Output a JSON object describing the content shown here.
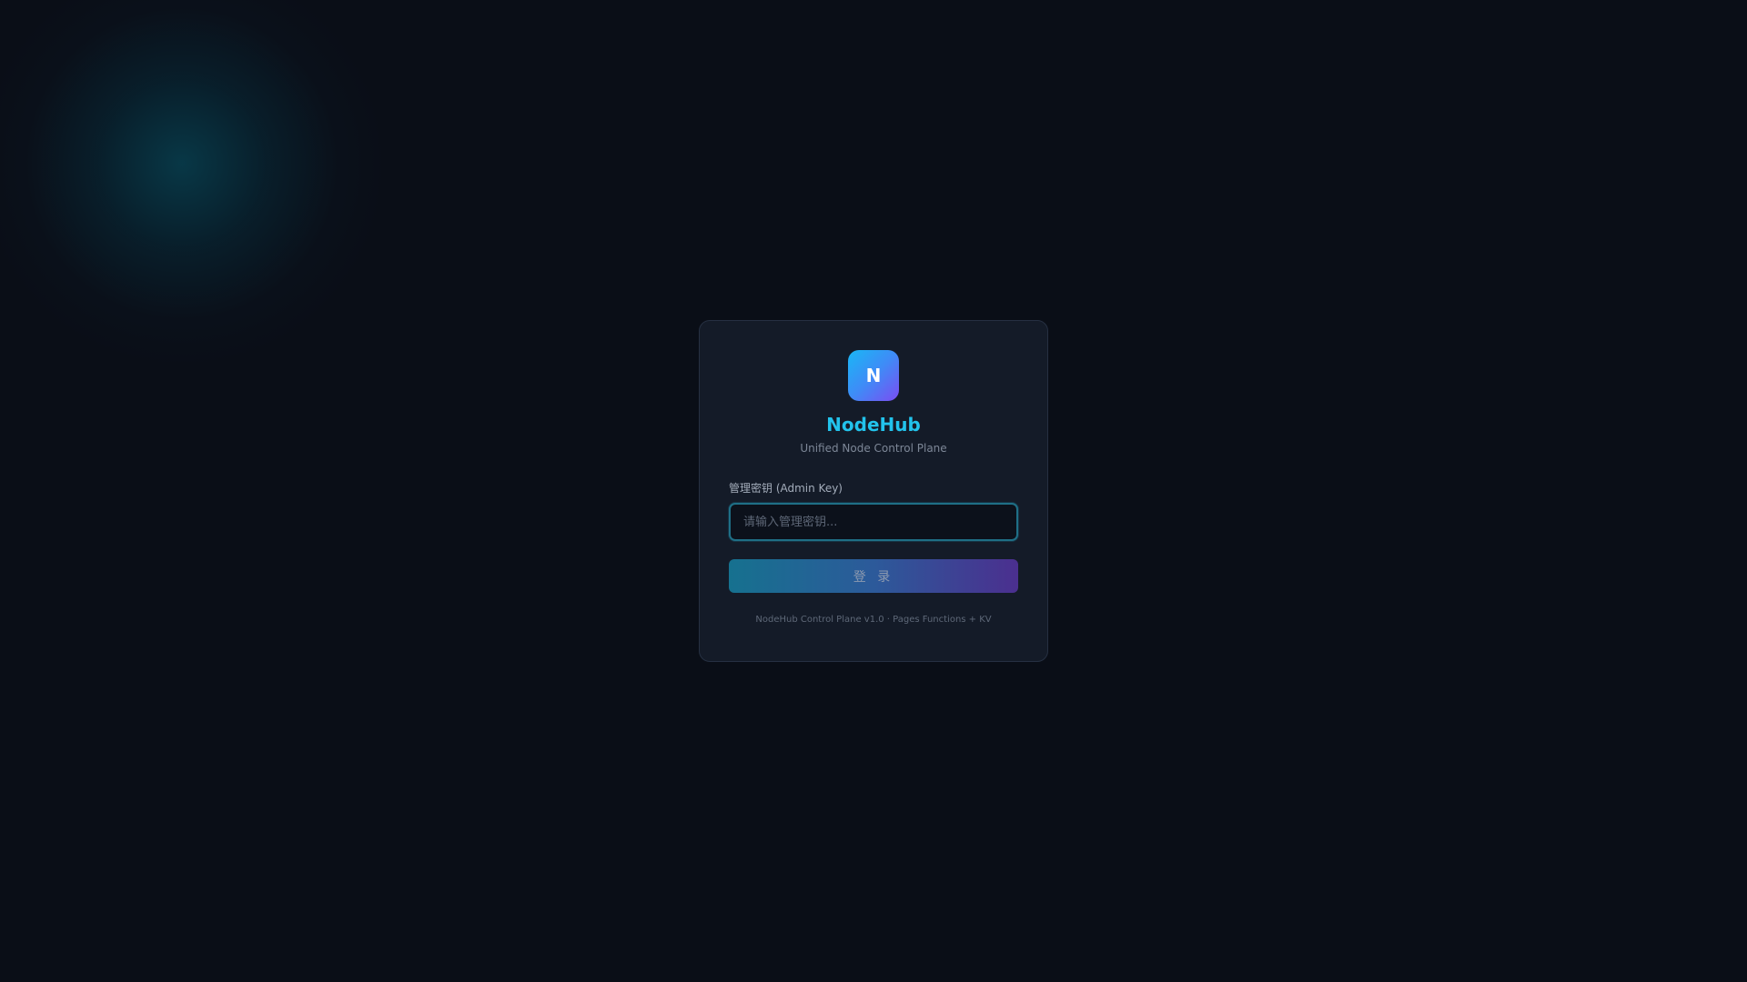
{
  "colors": {
    "background": "#0a0e17",
    "card": "#141b28",
    "accent": "#22c3ec",
    "brand_gradient_start": "#19b7f5",
    "brand_gradient_end": "#7b4df2"
  },
  "logo": {
    "letter": "N"
  },
  "app": {
    "title": "NodeHub",
    "subtitle": "Unified Node Control Plane"
  },
  "form": {
    "admin_key_label": "管理密钥 (Admin Key)",
    "admin_key_value": "",
    "admin_key_placeholder": "请输入管理密钥...",
    "login_label": "登 录"
  },
  "footer": {
    "text": "NodeHub Control Plane v1.0 · Pages Functions + KV"
  }
}
